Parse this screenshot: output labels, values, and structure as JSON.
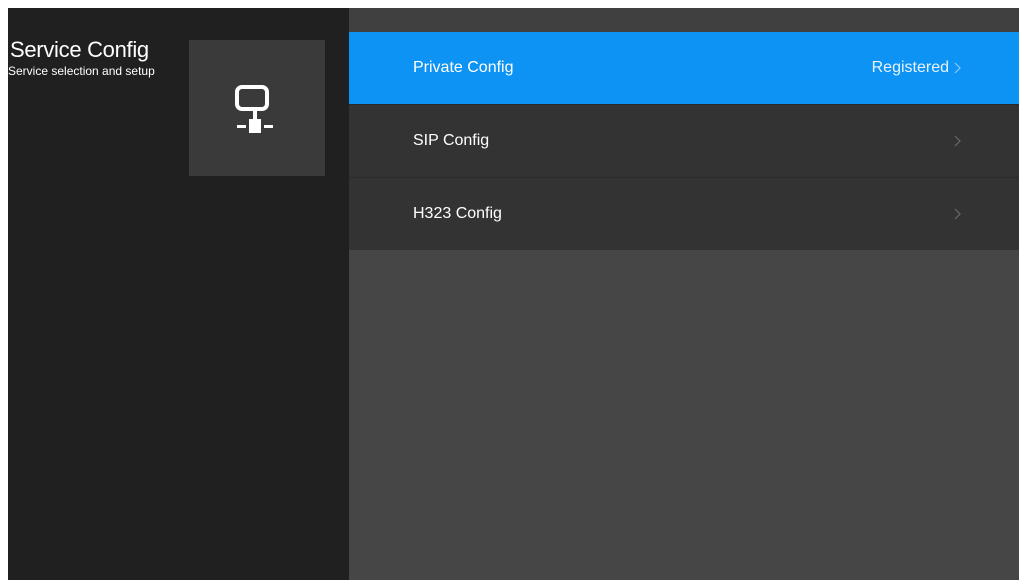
{
  "sidebar": {
    "title": "Service Config",
    "subtitle": "Service selection and setup",
    "tile_icon": "network-monitor-icon"
  },
  "menu": {
    "items": [
      {
        "label": "Private Config",
        "status": "Registered",
        "selected": true,
        "icon": "chevron-right-icon"
      },
      {
        "label": "SIP Config",
        "status": "",
        "selected": false,
        "icon": "chevron-right-icon"
      },
      {
        "label": "H323 Config",
        "status": "",
        "selected": false,
        "icon": "chevron-right-icon"
      }
    ]
  },
  "colors": {
    "selected_accent": "#0d93f3",
    "sidebar_bg": "#202020",
    "panel_bg": "#464646",
    "menu_item_bg": "#333333",
    "tile_bg": "#3a3a3a"
  }
}
